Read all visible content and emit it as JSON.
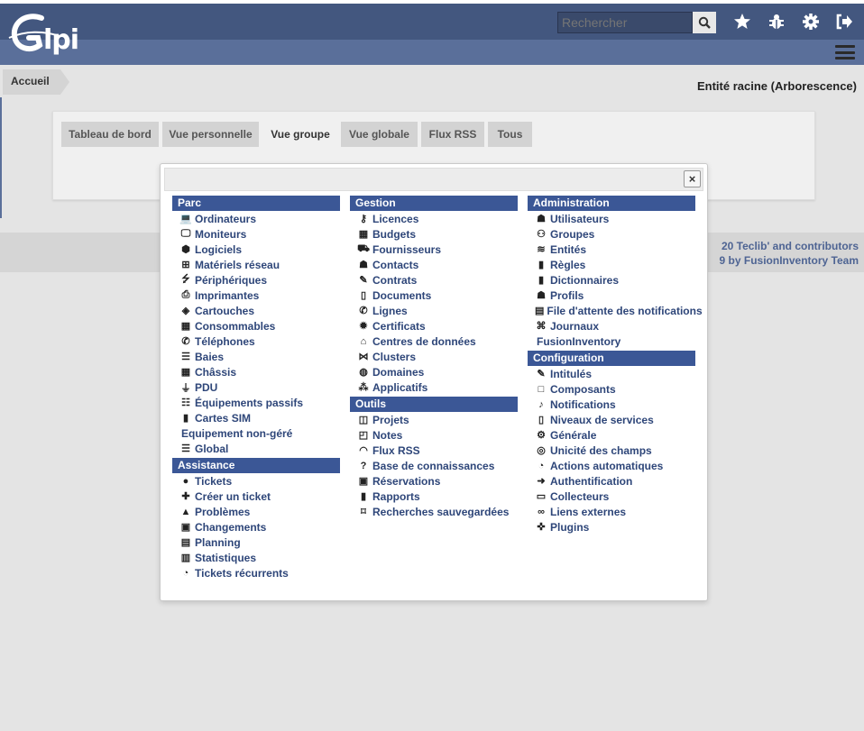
{
  "header": {
    "logo_text": "Glpi",
    "search_placeholder": "Rechercher",
    "icons": [
      "search-icon",
      "star-icon",
      "bug-icon",
      "gear-icon",
      "logout-icon",
      "menu-icon"
    ]
  },
  "breadcrumb": {
    "home": "Accueil"
  },
  "entity": "Entité racine (Arborescence)",
  "tabs": [
    "Tableau de bord",
    "Vue personnelle",
    "Vue groupe",
    "Vue globale",
    "Flux RSS",
    "Tous"
  ],
  "active_tab": "Vue groupe",
  "footer": {
    "line1": "20 Teclib' and contributors",
    "line2": "9 by FusionInventory Team"
  },
  "colors": {
    "header": "#43577f",
    "subheader": "#5a6f9a",
    "section": "#3b5796",
    "link": "#2e4679"
  },
  "menu": {
    "close_label": "×",
    "parc": {
      "title": "Parc",
      "items": [
        {
          "label": "Ordinateurs",
          "icon": "laptop-icon"
        },
        {
          "label": "Moniteurs",
          "icon": "monitor-icon"
        },
        {
          "label": "Logiciels",
          "icon": "cube-icon"
        },
        {
          "label": "Matériels réseau",
          "icon": "network-icon"
        },
        {
          "label": "Périphériques",
          "icon": "usb-icon"
        },
        {
          "label": "Imprimantes",
          "icon": "printer-icon"
        },
        {
          "label": "Cartouches",
          "icon": "fill-icon"
        },
        {
          "label": "Consommables",
          "icon": "boxes-icon"
        },
        {
          "label": "Téléphones",
          "icon": "phone-icon"
        },
        {
          "label": "Baies",
          "icon": "server-icon"
        },
        {
          "label": "Châssis",
          "icon": "grid-icon"
        },
        {
          "label": "PDU",
          "icon": "plug-icon"
        },
        {
          "label": "Équipements passifs",
          "icon": "th-list-icon"
        },
        {
          "label": "Cartes SIM",
          "icon": "sim-icon"
        },
        {
          "label": "Equipement non-géré",
          "icon": ""
        },
        {
          "label": "Global",
          "icon": "list-icon"
        }
      ]
    },
    "assistance": {
      "title": "Assistance",
      "items": [
        {
          "label": "Tickets",
          "icon": "exclamation-icon"
        },
        {
          "label": "Créer un ticket",
          "icon": "plus-icon"
        },
        {
          "label": "Problèmes",
          "icon": "warning-icon"
        },
        {
          "label": "Changements",
          "icon": "clipboard-check-icon"
        },
        {
          "label": "Planning",
          "icon": "calendar-icon"
        },
        {
          "label": "Statistiques",
          "icon": "chart-icon"
        },
        {
          "label": "Tickets récurrents",
          "icon": "stopwatch-icon"
        }
      ]
    },
    "gestion": {
      "title": "Gestion",
      "items": [
        {
          "label": "Licences",
          "icon": "key-icon"
        },
        {
          "label": "Budgets",
          "icon": "calculator-icon"
        },
        {
          "label": "Fournisseurs",
          "icon": "dolly-icon"
        },
        {
          "label": "Contacts",
          "icon": "user-tie-icon"
        },
        {
          "label": "Contrats",
          "icon": "signature-icon"
        },
        {
          "label": "Documents",
          "icon": "file-icon"
        },
        {
          "label": "Lignes",
          "icon": "phone-icon"
        },
        {
          "label": "Certificats",
          "icon": "certificate-icon"
        },
        {
          "label": "Centres de données",
          "icon": "warehouse-icon"
        },
        {
          "label": "Clusters",
          "icon": "project-diagram-icon"
        },
        {
          "label": "Domaines",
          "icon": "globe-icon"
        },
        {
          "label": "Applicatifs",
          "icon": "cubes-icon"
        }
      ]
    },
    "outils": {
      "title": "Outils",
      "items": [
        {
          "label": "Projets",
          "icon": "columns-icon"
        },
        {
          "label": "Notes",
          "icon": "sticky-note-icon"
        },
        {
          "label": "Flux RSS",
          "icon": "rss-icon"
        },
        {
          "label": "Base de connaissances",
          "icon": "question-icon"
        },
        {
          "label": "Réservations",
          "icon": "calendar-check-icon"
        },
        {
          "label": "Rapports",
          "icon": "book-icon"
        },
        {
          "label": "Recherches sauvegardées",
          "icon": "bookmark-icon"
        }
      ]
    },
    "administration": {
      "title": "Administration",
      "items": [
        {
          "label": "Utilisateurs",
          "icon": "user-icon"
        },
        {
          "label": "Groupes",
          "icon": "users-icon"
        },
        {
          "label": "Entités",
          "icon": "layers-icon"
        },
        {
          "label": "Règles",
          "icon": "book-icon"
        },
        {
          "label": "Dictionnaires",
          "icon": "book-icon"
        },
        {
          "label": "Profils",
          "icon": "user-check-icon"
        },
        {
          "label": "File d'attente des notifications",
          "icon": "list-alt-icon"
        },
        {
          "label": "Journaux",
          "icon": "scroll-icon"
        },
        {
          "label": "FusionInventory",
          "icon": ""
        }
      ]
    },
    "configuration": {
      "title": "Configuration",
      "items": [
        {
          "label": "Intitulés",
          "icon": "edit-icon"
        },
        {
          "label": "Composants",
          "icon": "square-icon"
        },
        {
          "label": "Notifications",
          "icon": "bell-icon"
        },
        {
          "label": "Niveaux de services",
          "icon": "file-contract-icon"
        },
        {
          "label": "Générale",
          "icon": "cog-icon"
        },
        {
          "label": "Unicité des champs",
          "icon": "fingerprint-icon"
        },
        {
          "label": "Actions automatiques",
          "icon": "stopwatch-icon"
        },
        {
          "label": "Authentification",
          "icon": "sign-in-icon"
        },
        {
          "label": "Collecteurs",
          "icon": "inbox-icon"
        },
        {
          "label": "Liens externes",
          "icon": "link-icon"
        },
        {
          "label": "Plugins",
          "icon": "puzzle-icon"
        }
      ]
    }
  }
}
